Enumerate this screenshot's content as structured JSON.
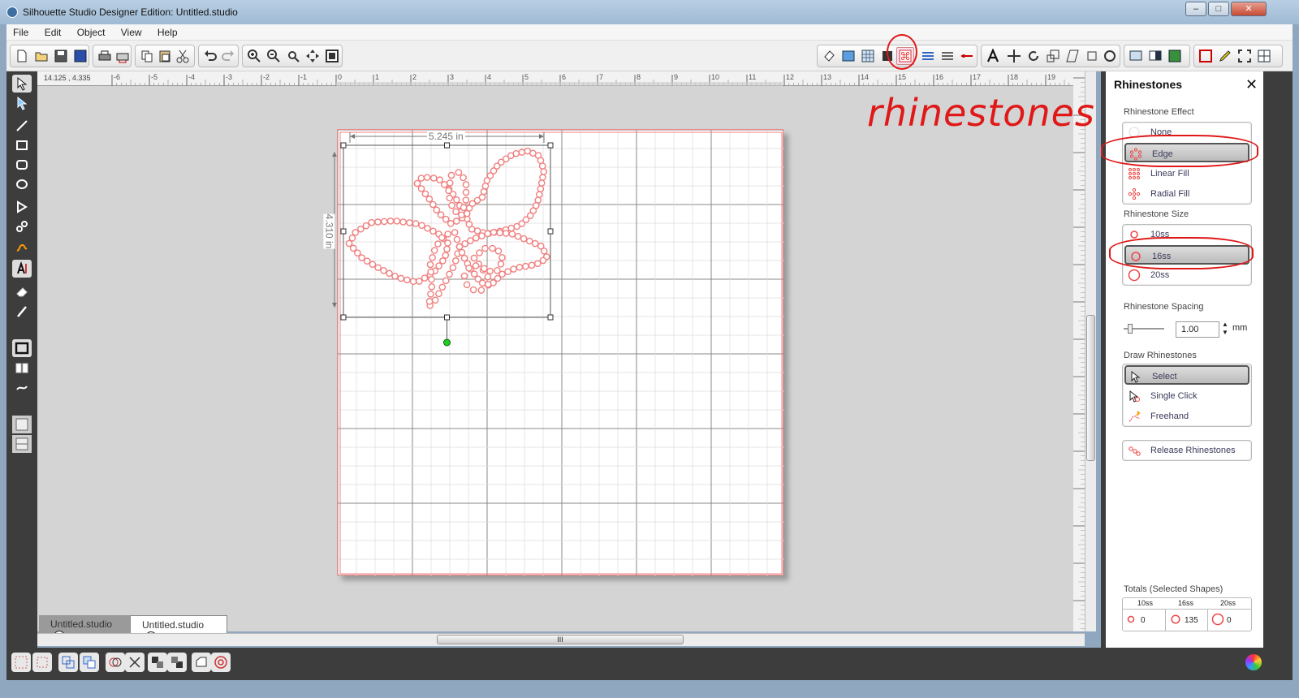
{
  "window": {
    "title": "Silhouette Studio Designer Edition: Untitled.studio",
    "min": "–",
    "max": "□",
    "close": "✕"
  },
  "menu": [
    "File",
    "Edit",
    "Object",
    "View",
    "Help"
  ],
  "coords": "14.125 , 4.335",
  "ruler": {
    "labels": [
      "-6",
      "-5",
      "-4",
      "-3",
      "-2",
      "-1",
      "0",
      "1",
      "2",
      "3",
      "4",
      "5",
      "6",
      "7",
      "8",
      "9",
      "10",
      "11",
      "12",
      "13",
      "14",
      "15",
      "16",
      "17",
      "18",
      "19"
    ]
  },
  "canvas": {
    "width_label": "5.245 in",
    "height_label": "4.310 in"
  },
  "tabs": [
    {
      "label": "Untitled.studio",
      "close": "✕"
    },
    {
      "label": "Untitled.studio",
      "close": "✕"
    }
  ],
  "scroll_grip": "III",
  "annotation": "rhinestones",
  "panel": {
    "title": "Rhinestones",
    "close": "✕",
    "effect": {
      "label": "Rhinestone Effect",
      "options": [
        "None",
        "Edge",
        "Linear Fill",
        "Radial Fill"
      ],
      "selected": "Edge"
    },
    "size": {
      "label": "Rhinestone Size",
      "options": [
        "10ss",
        "16ss",
        "20ss"
      ],
      "selected": "16ss"
    },
    "spacing": {
      "label": "Rhinestone Spacing",
      "value": "1.00",
      "unit": "mm",
      "slider_level": 0.1
    },
    "draw": {
      "label": "Draw Rhinestones",
      "options": [
        "Select",
        "Single Click",
        "Freehand"
      ],
      "selected": "Select"
    },
    "release": "Release Rhinestones",
    "totals": {
      "label": "Totals (Selected Shapes)",
      "headers": [
        "10ss",
        "16ss",
        "20ss"
      ],
      "values": [
        "0",
        "135",
        "0"
      ]
    }
  },
  "colors": {
    "accent_red": "#e01818",
    "rhinestone": "#f08080",
    "dark_chrome": "#3d3d3d"
  }
}
